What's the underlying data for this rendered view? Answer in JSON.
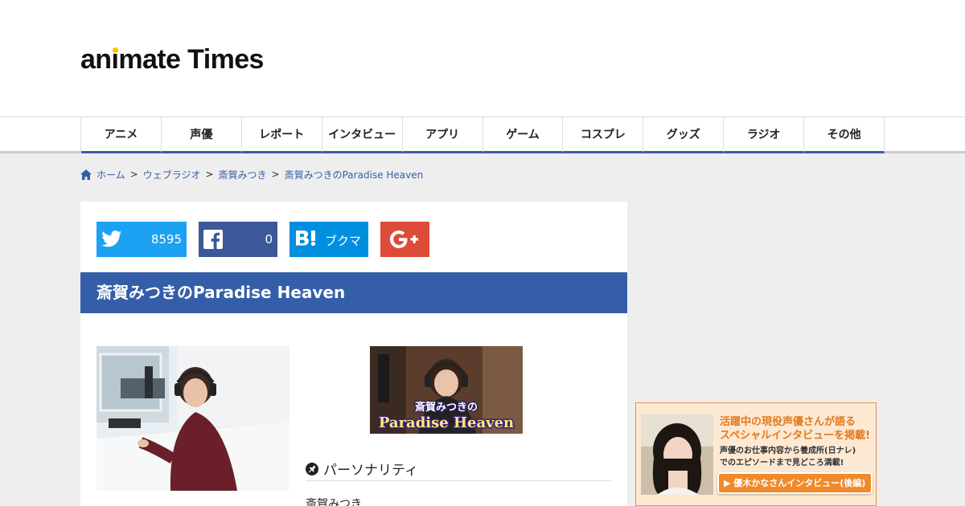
{
  "header": {
    "logo_prefix": "an",
    "logo_i": "i",
    "logo_middle": "mate T",
    "logo_i2": "i",
    "logo_suffix": "mes"
  },
  "nav": {
    "items": [
      "アニメ",
      "声優",
      "レポート",
      "インタビュー",
      "アプリ",
      "ゲーム",
      "コスプレ",
      "グッズ",
      "ラジオ",
      "その他"
    ]
  },
  "breadcrumb": {
    "items": [
      "ホーム",
      "ウェブラジオ",
      "斎賀みつき",
      "斎賀みつきのParadise Heaven"
    ],
    "separator": ">"
  },
  "share": {
    "twitter_count": "8595",
    "facebook_count": "0",
    "hatena_label": "ブクマ"
  },
  "article": {
    "title": "斎賀みつきのParadise Heaven",
    "banner_line1": "斎賀みつきの",
    "banner_line2": "Paradise Heaven",
    "section_title": "パーソナリティ",
    "personality": "斎賀みつき"
  },
  "ad": {
    "line1": "活躍中の現役声優さんが語る",
    "line2": "スペシャルインタビューを掲載!",
    "line3": "声優のお仕事内容から養成所(日ナレ)",
    "line4": "でのエピソードまで見どころ満載!",
    "button": "▶ 優木かなさんインタビュー(後編)"
  },
  "colors": {
    "accent": "#345fa8",
    "twitter": "#1da1f2",
    "facebook": "#3b5998",
    "hatena": "#008fde",
    "google": "#dd4b39"
  }
}
